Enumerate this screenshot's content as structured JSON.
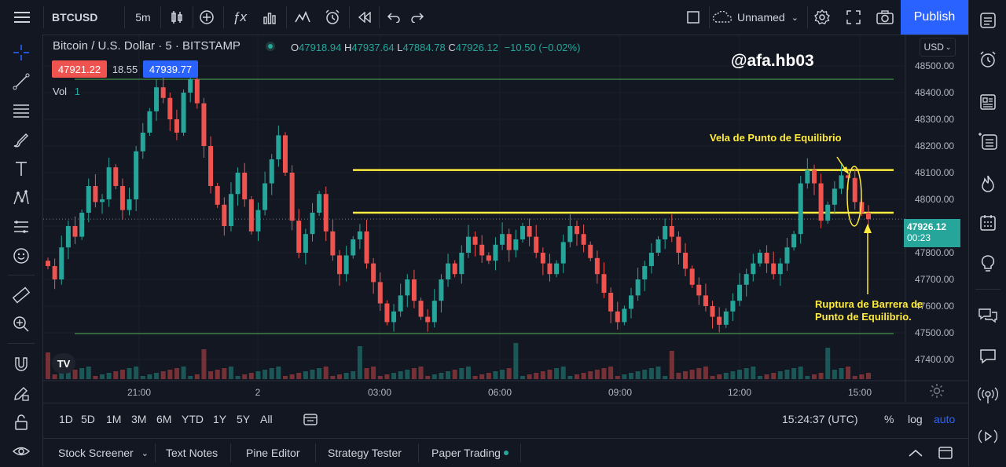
{
  "header": {
    "symbol": "BTCUSD",
    "interval": "5m",
    "layout_name": "Unnamed",
    "publish_label": "Publish"
  },
  "legend": {
    "title": "Bitcoin / U.S. Dollar · 5 · BITSTAMP",
    "o_label": "O",
    "o_value": "47918.94",
    "h_label": "H",
    "h_value": "47937.64",
    "l_label": "L",
    "l_value": "47884.78",
    "c_label": "C",
    "c_value": "47926.12",
    "change": "−10.50 (−0.02%)",
    "bid": "47921.22",
    "spread": "18.55",
    "ask": "47939.77",
    "vol_label": "Vol",
    "vol_value": "1"
  },
  "watermark": "@afa.hb03",
  "currency": "USD",
  "last_price": {
    "value": "47926.12",
    "countdown": "00:23"
  },
  "colors": {
    "up": "#26a69a",
    "down": "#ef5350",
    "accent": "#2962ff",
    "annotation": "#ffeb3b",
    "level_green": "#4caf50"
  },
  "chart_data": {
    "type": "candlestick",
    "ylim": [
      47350,
      48600
    ],
    "y_ticks": [
      "48500.00",
      "48400.00",
      "48300.00",
      "48200.00",
      "48100.00",
      "48000.00",
      "47900.00",
      "47800.00",
      "47700.00",
      "47600.00",
      "47500.00",
      "47400.00"
    ],
    "x_ticks": [
      "21:00",
      "2",
      "03:00",
      "06:00",
      "09:00",
      "12:00",
      "15:00"
    ],
    "levels": [
      {
        "value": 48450,
        "color": "green"
      },
      {
        "value": 47497,
        "color": "green"
      },
      {
        "value": 48110,
        "color": "yellow"
      },
      {
        "value": 47950,
        "color": "yellow"
      }
    ],
    "annotations": [
      {
        "text": "Vela de Punto de Equilibrio"
      },
      {
        "text": "Ruptura de Barrera de"
      },
      {
        "text": "Punto de Equilibrio."
      }
    ],
    "closes": [
      47750,
      47700,
      47820,
      47900,
      47860,
      47950,
      48050,
      47990,
      48000,
      48120,
      48050,
      47960,
      48000,
      48180,
      48250,
      48330,
      48420,
      48380,
      48300,
      48250,
      48400,
      48450,
      48360,
      48200,
      48050,
      47980,
      47900,
      48020,
      48100,
      48000,
      47880,
      47960,
      48060,
      48150,
      48240,
      48100,
      47920,
      47800,
      47870,
      47950,
      48020,
      47880,
      47790,
      47720,
      47790,
      47850,
      47880,
      47760,
      47690,
      47610,
      47540,
      47580,
      47640,
      47700,
      47620,
      47560,
      47540,
      47620,
      47700,
      47760,
      47720,
      47800,
      47860,
      47830,
      47790,
      47770,
      47830,
      47870,
      47810,
      47850,
      47900,
      47860,
      47800,
      47760,
      47720,
      47760,
      47840,
      47900,
      47870,
      47830,
      47780,
      47720,
      47650,
      47580,
      47540,
      47590,
      47640,
      47700,
      47750,
      47800,
      47850,
      47900,
      47860,
      47800,
      47740,
      47680,
      47640,
      47600,
      47560,
      47530,
      47580,
      47620,
      47680,
      47720,
      47760,
      47800,
      47760,
      47720,
      47760,
      47820,
      47870,
      48060,
      48110,
      48060,
      47920,
      47980,
      48040,
      48090,
      48080,
      47990,
      47950,
      47926
    ]
  },
  "range_bar": {
    "ranges": [
      "1D",
      "5D",
      "1M",
      "3M",
      "6M",
      "YTD",
      "1Y",
      "5Y",
      "All"
    ],
    "clock": "15:24:37 (UTC)",
    "percent": "%",
    "log": "log",
    "auto": "auto"
  },
  "bottom_tabs": [
    "Stock Screener",
    "Text Notes",
    "Pine Editor",
    "Strategy Tester",
    "Paper Trading"
  ]
}
